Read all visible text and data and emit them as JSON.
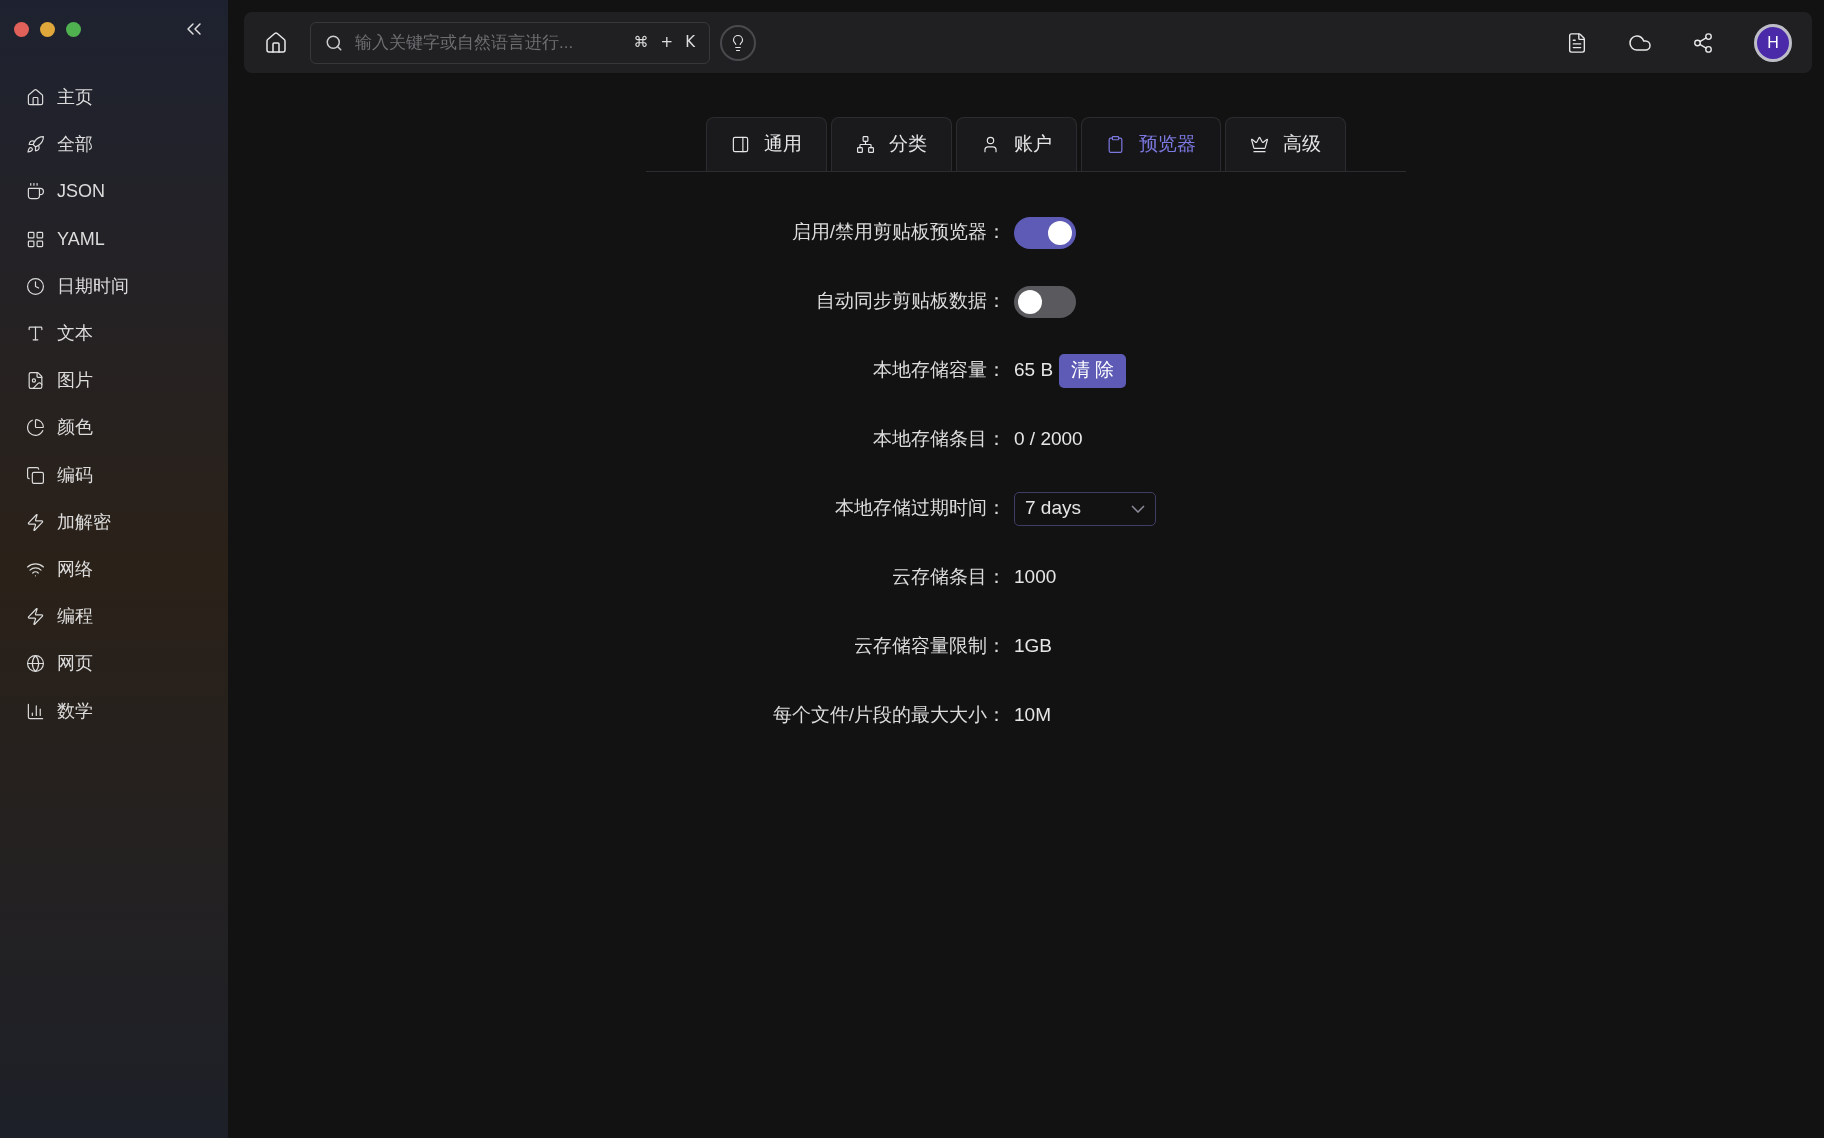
{
  "sidebar": {
    "items": [
      {
        "label": "主页",
        "selected": false
      },
      {
        "label": "全部",
        "selected": false
      },
      {
        "label": "JSON",
        "selected": false
      },
      {
        "label": "YAML",
        "selected": false
      },
      {
        "label": "日期时间",
        "selected": false
      },
      {
        "label": "文本",
        "selected": false
      },
      {
        "label": "图片",
        "selected": false
      },
      {
        "label": "颜色",
        "selected": false
      },
      {
        "label": "编码",
        "selected": false
      },
      {
        "label": "加解密",
        "selected": false
      },
      {
        "label": "网络",
        "selected": false
      },
      {
        "label": "编程",
        "selected": false
      },
      {
        "label": "网页",
        "selected": false
      },
      {
        "label": "数学",
        "selected": false
      }
    ]
  },
  "topbar": {
    "search": {
      "placeholder": "输入关键字或自然语言进行...",
      "shortcut": [
        "⌘",
        "+",
        "K"
      ]
    },
    "avatar": "H"
  },
  "tabs": [
    {
      "label": "通用",
      "selected": false
    },
    {
      "label": "分类",
      "selected": false
    },
    {
      "label": "账户",
      "selected": false
    },
    {
      "label": "预览器",
      "selected": true
    },
    {
      "label": "高级",
      "selected": false
    }
  ],
  "settings": [
    {
      "kind": "toggle",
      "label": "启用/禁用剪贴板预览器：",
      "on": true
    },
    {
      "kind": "toggle",
      "label": "自动同步剪贴板数据：",
      "on": false
    },
    {
      "kind": "value",
      "label": "本地存储容量：",
      "value": "65 B",
      "button": "清 除"
    },
    {
      "kind": "value",
      "label": "本地存储条目：",
      "value": "0 / 2000"
    },
    {
      "kind": "select",
      "label": "本地存储过期时间：",
      "value": "7 days"
    },
    {
      "kind": "value",
      "label": "云存储条目：",
      "value": "1000"
    },
    {
      "kind": "value",
      "label": "云存储容量限制：",
      "value": "1GB"
    },
    {
      "kind": "value",
      "label": "每个文件/片段的最大大小：",
      "value": "10M"
    }
  ]
}
